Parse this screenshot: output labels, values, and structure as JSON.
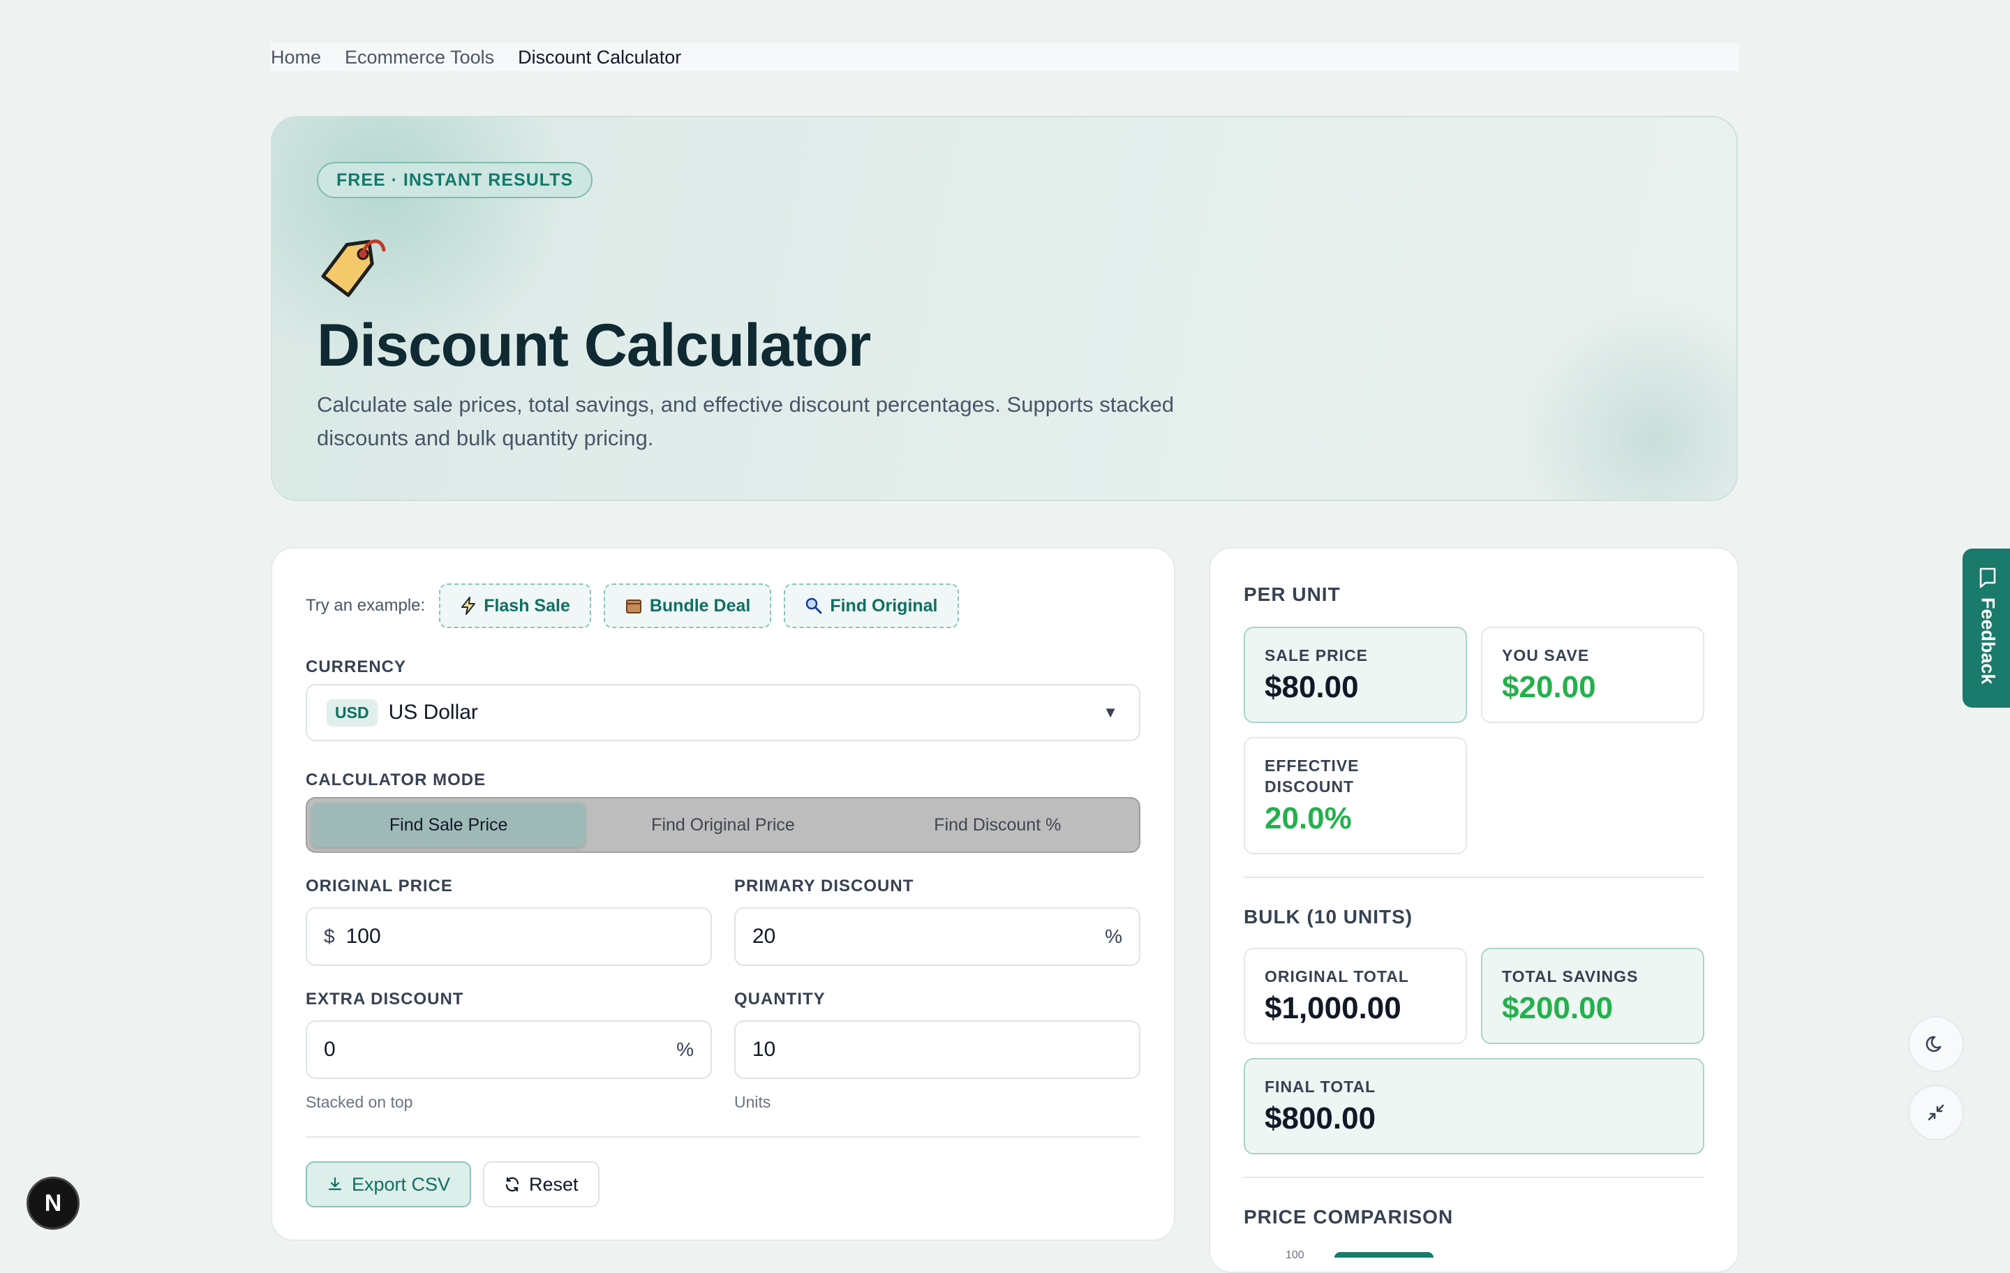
{
  "breadcrumb": {
    "items": [
      "Home",
      "Ecommerce Tools",
      "Discount Calculator"
    ]
  },
  "hero": {
    "badge": "FREE · INSTANT RESULTS",
    "icon": "price-tag-icon",
    "title": "Discount Calculator",
    "description": "Calculate sale prices, total savings, and effective discount percentages. Supports stacked discounts and bulk quantity pricing."
  },
  "examples": {
    "label": "Try an example:",
    "items": [
      {
        "label": "Flash Sale",
        "icon": "lightning-icon"
      },
      {
        "label": "Bundle Deal",
        "icon": "box-icon"
      },
      {
        "label": "Find Original",
        "icon": "magnifier-icon"
      }
    ]
  },
  "currency": {
    "label": "CURRENCY",
    "code": "USD",
    "name": "US Dollar",
    "caret": "▼"
  },
  "mode": {
    "label": "CALCULATOR MODE",
    "options": [
      "Find Sale Price",
      "Find Original Price",
      "Find Discount %"
    ],
    "selected": "Find Sale Price"
  },
  "fields": {
    "original_price": {
      "label": "ORIGINAL PRICE",
      "prefix": "$",
      "value": "100"
    },
    "primary_discount": {
      "label": "PRIMARY DISCOUNT",
      "value": "20",
      "suffix": "%"
    },
    "extra_discount": {
      "label": "EXTRA DISCOUNT",
      "value": "0",
      "suffix": "%",
      "hint": "Stacked on top"
    },
    "quantity": {
      "label": "QUANTITY",
      "value": "10",
      "hint": "Units"
    }
  },
  "actions": {
    "export": "Export CSV",
    "reset": "Reset"
  },
  "per_unit": {
    "title": "PER UNIT",
    "sale_price": {
      "label": "SALE PRICE",
      "value": "$80.00"
    },
    "you_save": {
      "label": "YOU SAVE",
      "value": "$20.00"
    },
    "effective_discount": {
      "label": "EFFECTIVE DISCOUNT",
      "value": "20.0%"
    }
  },
  "bulk": {
    "title": "BULK (10 UNITS)",
    "original_total": {
      "label": "ORIGINAL TOTAL",
      "value": "$1,000.00"
    },
    "total_savings": {
      "label": "TOTAL SAVINGS",
      "value": "$200.00"
    },
    "final_total": {
      "label": "FINAL TOTAL",
      "value": "$800.00"
    }
  },
  "comparison": {
    "title": "PRICE COMPARISON",
    "tick": "100"
  },
  "feedback": {
    "label": "Feedback"
  },
  "next_badge": {
    "letter": "N"
  },
  "colors": {
    "accent": "#1a7a6b",
    "positive": "#22b14c",
    "background": "#eef3f2"
  }
}
